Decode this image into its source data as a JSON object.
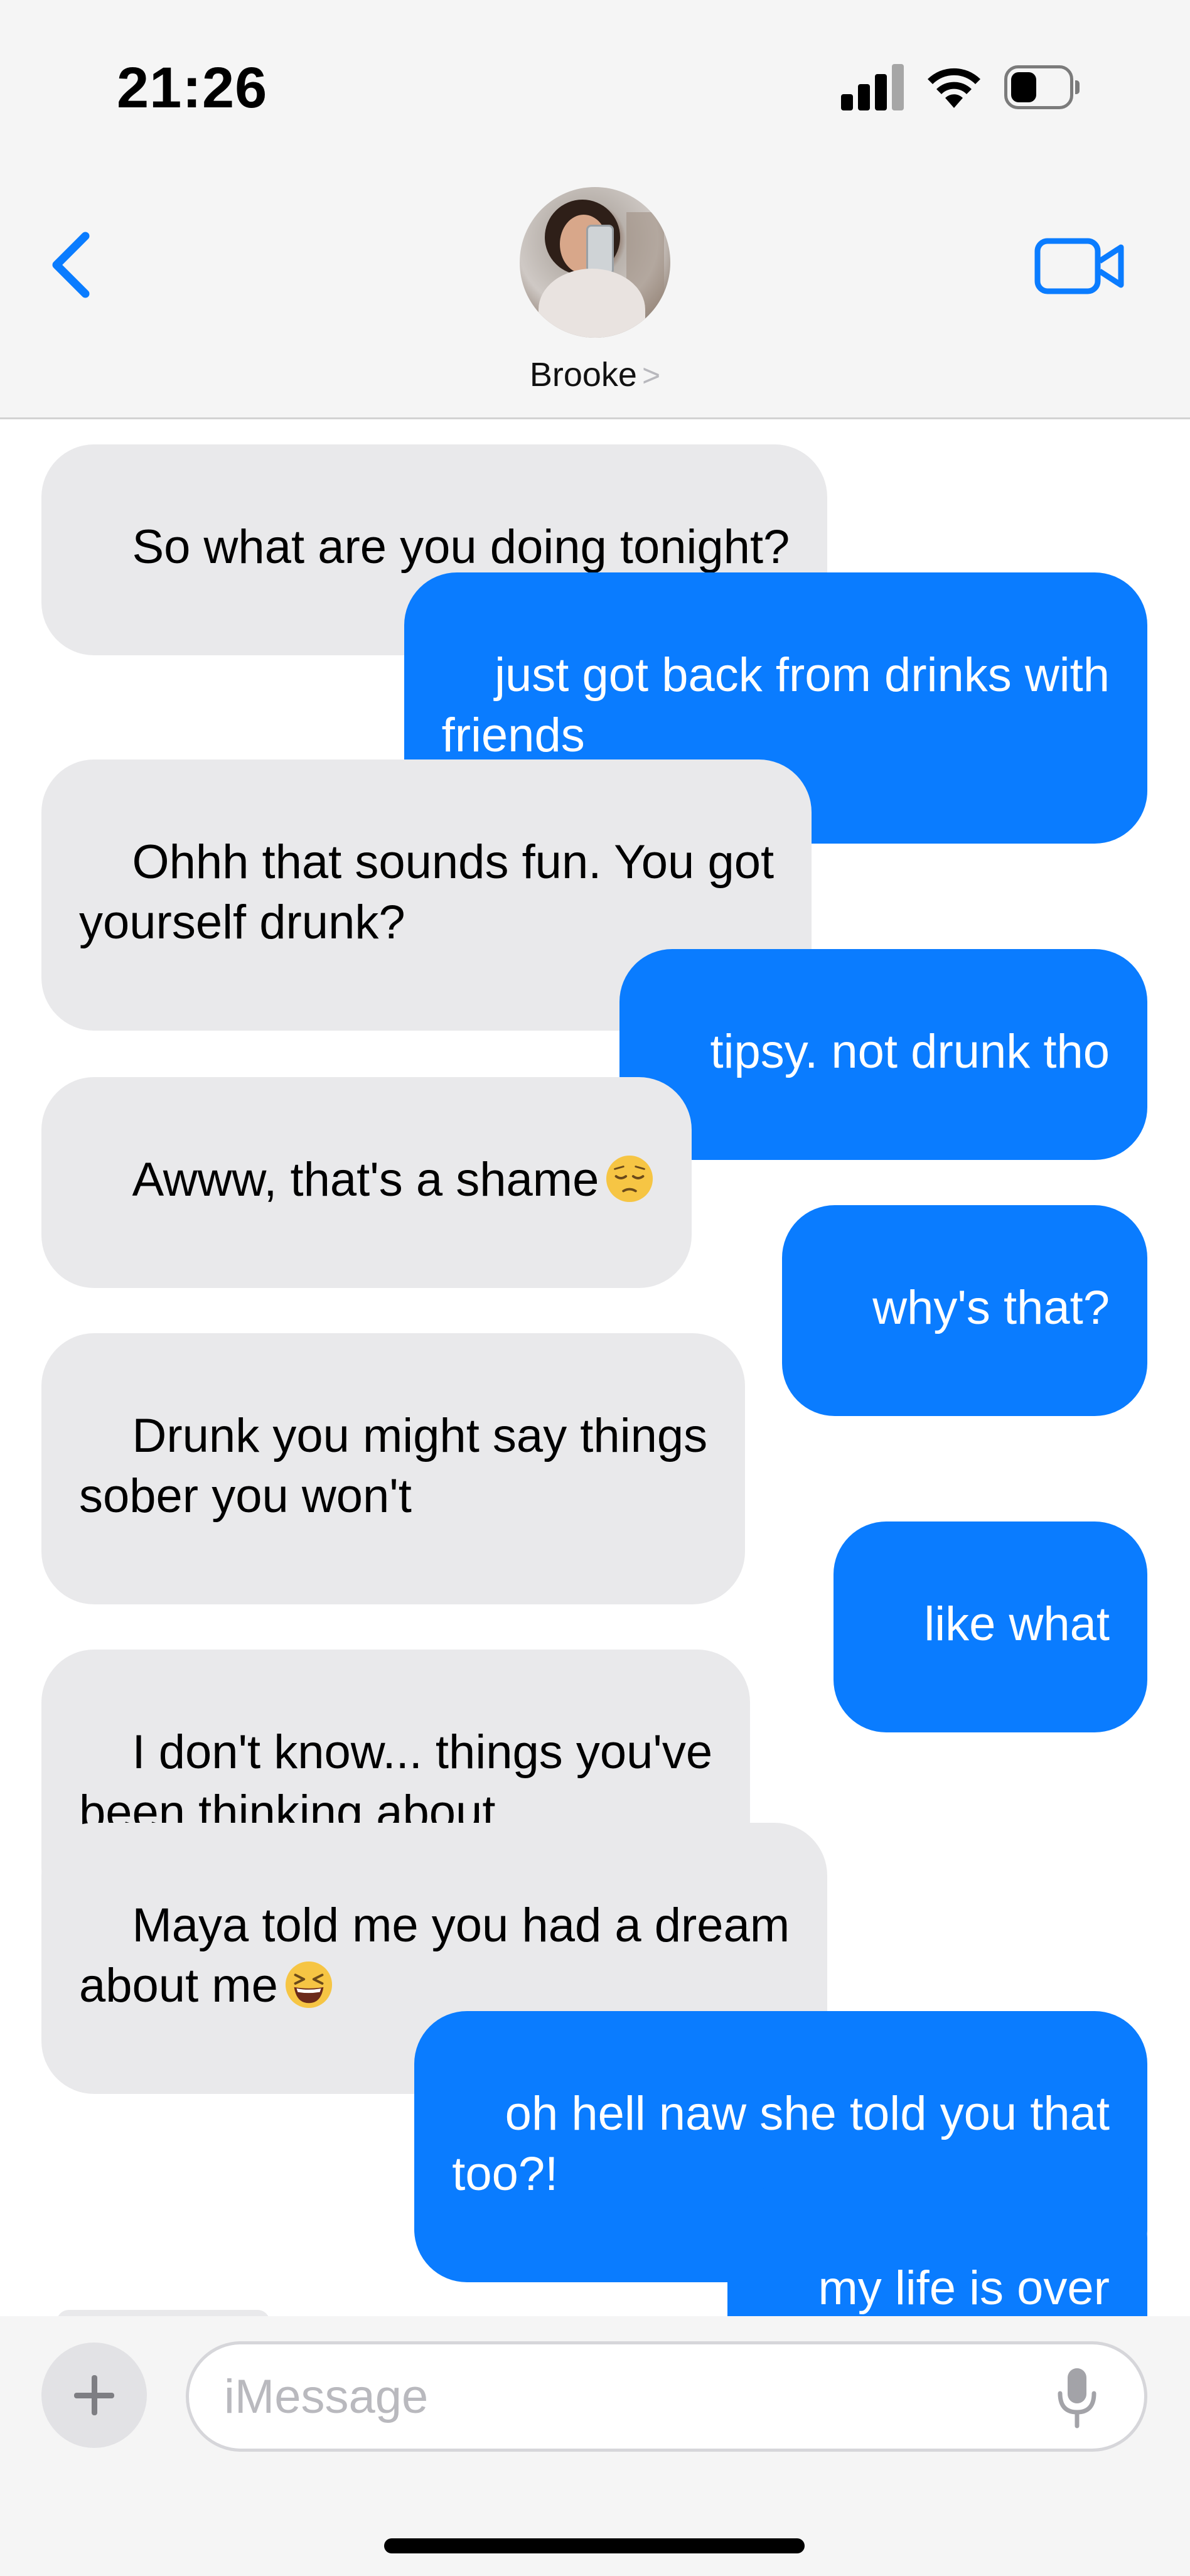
{
  "status_bar": {
    "time": "21:26",
    "battery_level": 0.45
  },
  "header": {
    "contact_name": "Brooke",
    "contact_chevron": ">",
    "icons": {
      "back": "chevron-left-icon",
      "video": "video-camera-icon"
    },
    "accent_color": "#0a7cff"
  },
  "messages": [
    {
      "from": "them",
      "text": "So what are you doing tonight?"
    },
    {
      "from": "me",
      "text": "just got back from drinks with\nfriends"
    },
    {
      "from": "them",
      "text": "Ohhh that sounds fun. You got\nyourself drunk?"
    },
    {
      "from": "me",
      "text": "tipsy. not drunk tho"
    },
    {
      "from": "them",
      "text": "Awww, that's a shame",
      "emoji": "pensive-face-emoji"
    },
    {
      "from": "me",
      "text": "why's that?"
    },
    {
      "from": "them",
      "text": "Drunk you might say things\nsober you won't"
    },
    {
      "from": "me",
      "text": "like what"
    },
    {
      "from": "them",
      "text": "I don't know... things you've\nbeen thinking about"
    },
    {
      "from": "them",
      "text": "Maya told me you had a dream\nabout me",
      "emoji": "grinning-squinting-face-emoji"
    },
    {
      "from": "me",
      "text": "oh hell naw she told you that\ntoo?!"
    },
    {
      "from": "me",
      "text": "my life is over"
    }
  ],
  "composer": {
    "placeholder": "iMessage",
    "value": "",
    "icons": {
      "plus": "plus-icon",
      "mic": "microphone-icon"
    }
  },
  "colors": {
    "incoming_bubble": "#e9e9eb",
    "outgoing_bubble": "#0a7cff",
    "header_bg": "#f5f5f5"
  }
}
